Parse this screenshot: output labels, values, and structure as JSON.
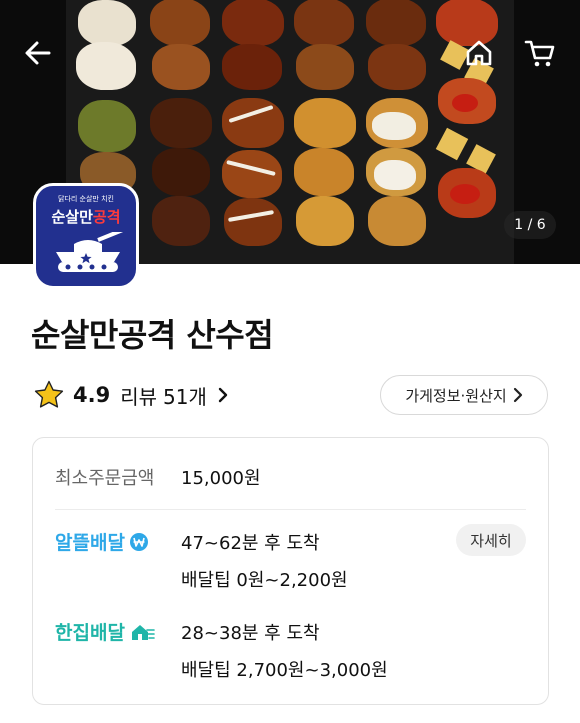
{
  "hero": {
    "image_label": "fried-chicken-tray-photo",
    "counter": "1 / 6"
  },
  "top_bar": {
    "back_icon": "arrow-left-icon",
    "home_icon": "home-icon",
    "cart_icon": "cart-icon"
  },
  "logo": {
    "subtitle": "닭다리 순살만 치킨",
    "title_white": "순살만",
    "title_red": "공격"
  },
  "store": {
    "name": "순살만공격 산수점",
    "rating": "4.9",
    "review_label": "리뷰",
    "review_count": "51개",
    "info_button": "가게정보·원산지"
  },
  "delivery": {
    "min_order_label": "최소주문금액",
    "min_order_value": "15,000원",
    "options": [
      {
        "brand": "알뜰배달",
        "time": "47~62분 후 도착",
        "tip": "배달팁 0원~2,200원",
        "detail_button": "자세히",
        "color": "#2ea8e8"
      },
      {
        "brand": "한집배달",
        "time": "28~38분 후 도착",
        "tip": "배달팁 2,700원~3,000원",
        "color": "#1fb5a8"
      }
    ]
  },
  "colors": {
    "logo_bg": "#22308f",
    "star": "#f4c21a"
  }
}
